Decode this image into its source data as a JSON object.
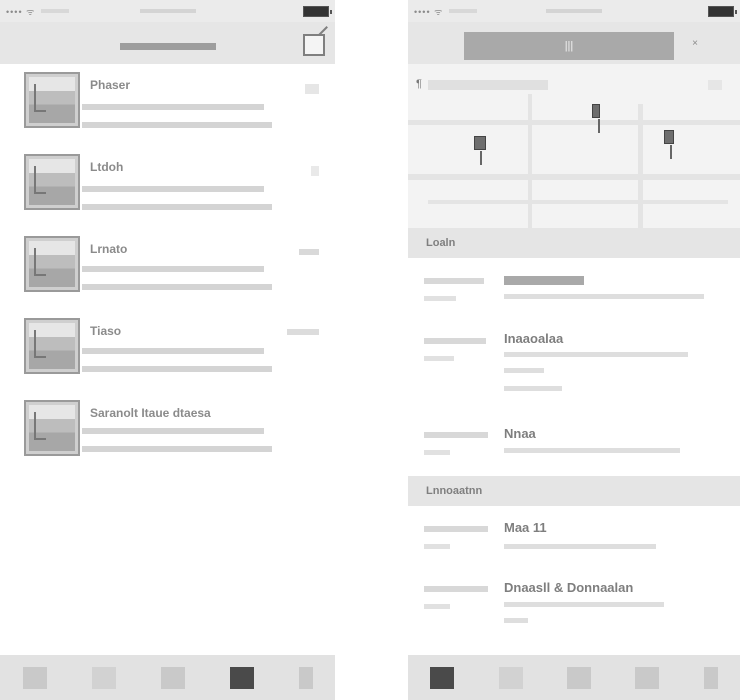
{
  "left_screen": {
    "status": {
      "carrier": "•••• ᯤ"
    },
    "nav": {
      "title": ""
    },
    "messages": [
      {
        "sender": "Phaser",
        "date": ""
      },
      {
        "sender": "Ltdoh",
        "date": ""
      },
      {
        "sender": "Lrnato",
        "date": ""
      },
      {
        "sender": "Tiaso",
        "date": ""
      },
      {
        "sender": "Saranolt Itaue dtaesa",
        "date": ""
      }
    ],
    "tabs": [
      {
        "label": ""
      },
      {
        "label": ""
      },
      {
        "label": ""
      },
      {
        "label": ""
      },
      {
        "label": ""
      }
    ]
  },
  "right_screen": {
    "status": {
      "carrier": "•••• ᯤ"
    },
    "nav": {
      "segment_label": "|||",
      "right_glyph": "×"
    },
    "map": {
      "header_glyph": "¶"
    },
    "sections": [
      {
        "title": "Loaln"
      },
      {
        "title": "Lnnoaatnn"
      }
    ],
    "details": [
      {
        "label": "",
        "value": ""
      },
      {
        "label": "",
        "value": "Inaaoalaa"
      },
      {
        "label": "",
        "value": "Nnaa"
      },
      {
        "label": "",
        "value": "Maa 11"
      },
      {
        "label": "",
        "value": "Dnaasll & Donnaalan"
      }
    ],
    "tabs": [
      {
        "label": ""
      },
      {
        "label": ""
      },
      {
        "label": ""
      },
      {
        "label": ""
      },
      {
        "label": ""
      }
    ]
  }
}
